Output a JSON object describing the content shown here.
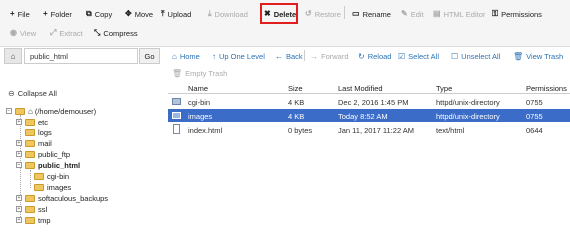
{
  "toolbar": {
    "file": "File",
    "folder": "Folder",
    "copy": "Copy",
    "move": "Move",
    "upload": "Upload",
    "download": "Download",
    "delete": "Delete",
    "restore": "Restore",
    "rename": "Rename",
    "edit": "Edit",
    "html_editor": "HTML Editor",
    "permissions": "Permissions",
    "view": "View",
    "extract": "Extract",
    "compress": "Compress"
  },
  "path_bar": {
    "path_value": "public_html",
    "go": "Go"
  },
  "nav": {
    "home": "Home",
    "up": "Up One Level",
    "back": "Back",
    "forward": "Forward",
    "reload": "Reload",
    "select_all": "Select All",
    "unselect_all": "Unselect All",
    "view_trash": "View Trash",
    "empty_trash": "Empty Trash"
  },
  "sidebar": {
    "collapse_all": "Collapse All",
    "root": "(/home/demouser)",
    "items": {
      "etc": "etc",
      "logs": "logs",
      "mail": "mail",
      "public_ftp": "public_ftp",
      "public_html": "public_html",
      "cgi_bin": "cgi-bin",
      "images": "images",
      "softaculous_backups": "softaculous_backups",
      "ssl": "ssl",
      "tmp": "tmp"
    }
  },
  "table": {
    "headers": {
      "name": "Name",
      "size": "Size",
      "last_modified": "Last Modified",
      "type": "Type",
      "permissions": "Permissions"
    },
    "rows": [
      {
        "name": "cgi-bin",
        "size": "4 KB",
        "modified": "Dec 2, 2016 1:45 PM",
        "type": "httpd/unix-directory",
        "perms": "0755",
        "icon": "folder-icon"
      },
      {
        "name": "images",
        "size": "4 KB",
        "modified": "Today 8:52 AM",
        "type": "httpd/unix-directory",
        "perms": "0755",
        "icon": "folder-icon",
        "selected": true
      },
      {
        "name": "index.html",
        "size": "0 bytes",
        "modified": "Jan 11, 2017 11:22 AM",
        "type": "text/html",
        "perms": "0644",
        "icon": "html-file-icon"
      }
    ]
  },
  "colors": {
    "accent": "#2a72b5",
    "selected_row": "#3b6cc7",
    "highlight_box": "#e01e1e"
  }
}
